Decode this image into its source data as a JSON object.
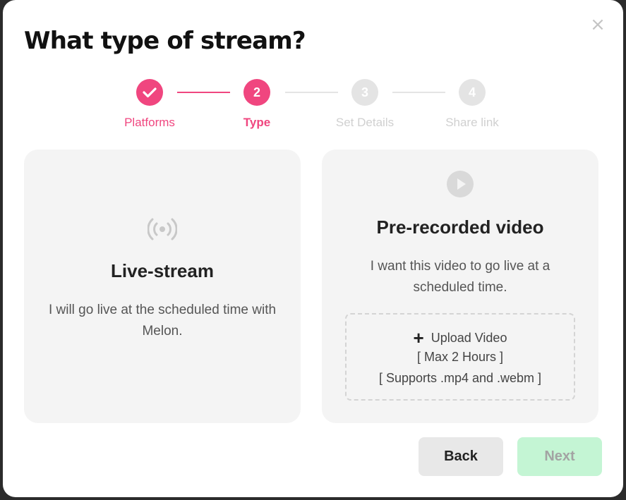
{
  "dialog": {
    "title": "What type of stream?",
    "close_glyph": "×"
  },
  "stepper": {
    "steps": [
      {
        "label": "Platforms",
        "number": "1",
        "state": "done",
        "icon": "check-icon"
      },
      {
        "label": "Type",
        "number": "2",
        "state": "active"
      },
      {
        "label": "Set Details",
        "number": "3",
        "state": "todo"
      },
      {
        "label": "Share link",
        "number": "4",
        "state": "todo"
      }
    ]
  },
  "options": {
    "live": {
      "icon": "broadcast-icon",
      "title": "Live-stream",
      "desc": "I will go live at the scheduled time with Melon."
    },
    "prerecorded": {
      "icon": "play-icon",
      "title": "Pre-recorded video",
      "desc": "I want this video to go live at a scheduled time.",
      "upload": {
        "plus_glyph": "+",
        "label": "Upload Video",
        "max": "[ Max 2 Hours ]",
        "formats": "[ Supports .mp4 and .webm ]"
      }
    }
  },
  "footer": {
    "back_label": "Back",
    "next_label": "Next"
  },
  "colors": {
    "accent": "#f0467f",
    "inactive": "#e4e4e4",
    "next_disabled": "#c4f5d4"
  }
}
